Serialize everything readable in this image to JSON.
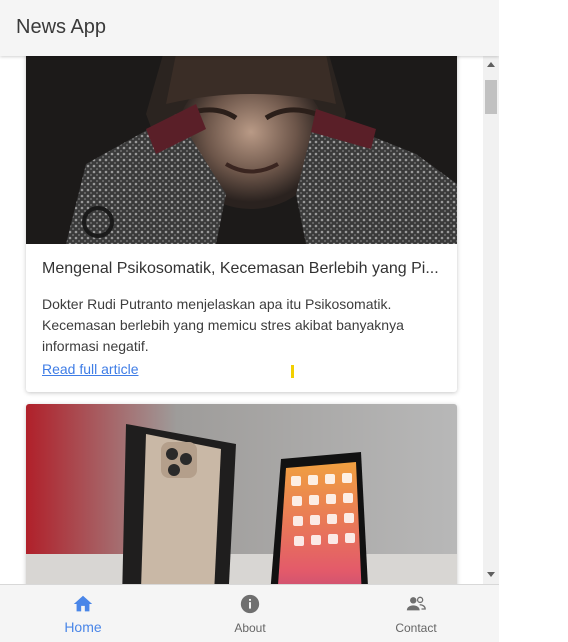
{
  "header": {
    "title": "News App"
  },
  "articles": [
    {
      "title": "Mengenal Psikosomatik, Kecemasan Berlebih yang Pi...",
      "description": "Dokter Rudi Putranto menjelaskan apa itu Psikosomatik. Kecemasan berlebih yang memicu stres akibat banyaknya informasi negatif.",
      "link_label": "Read full article",
      "image": "distressed-person-photo"
    },
    {
      "image": "smartphone-box-photo"
    }
  ],
  "bottom_nav": {
    "items": [
      {
        "label": "Home",
        "icon": "home-icon",
        "active": true
      },
      {
        "label": "About",
        "icon": "info-icon",
        "active": false
      },
      {
        "label": "Contact",
        "icon": "contacts-icon",
        "active": false
      }
    ]
  },
  "colors": {
    "accent": "#4a86e8",
    "link": "#3f7de6",
    "background": "#f5f5f5"
  }
}
